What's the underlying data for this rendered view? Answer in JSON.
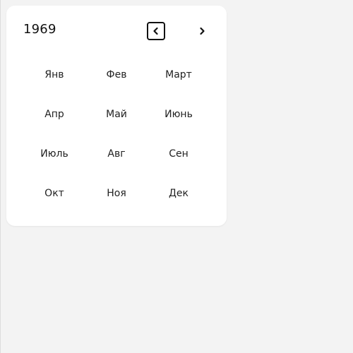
{
  "picker": {
    "year": "1969",
    "prev_icon": "chevron-left-icon",
    "next_icon": "chevron-right-icon",
    "months": [
      "Янв",
      "Фев",
      "Март",
      "Апр",
      "Май",
      "Июнь",
      "Июль",
      "Авг",
      "Сен",
      "Окт",
      "Ноя",
      "Дек"
    ]
  },
  "colors": {
    "background": "#f3f3f3",
    "card": "#ffffff",
    "text": "#111111"
  }
}
